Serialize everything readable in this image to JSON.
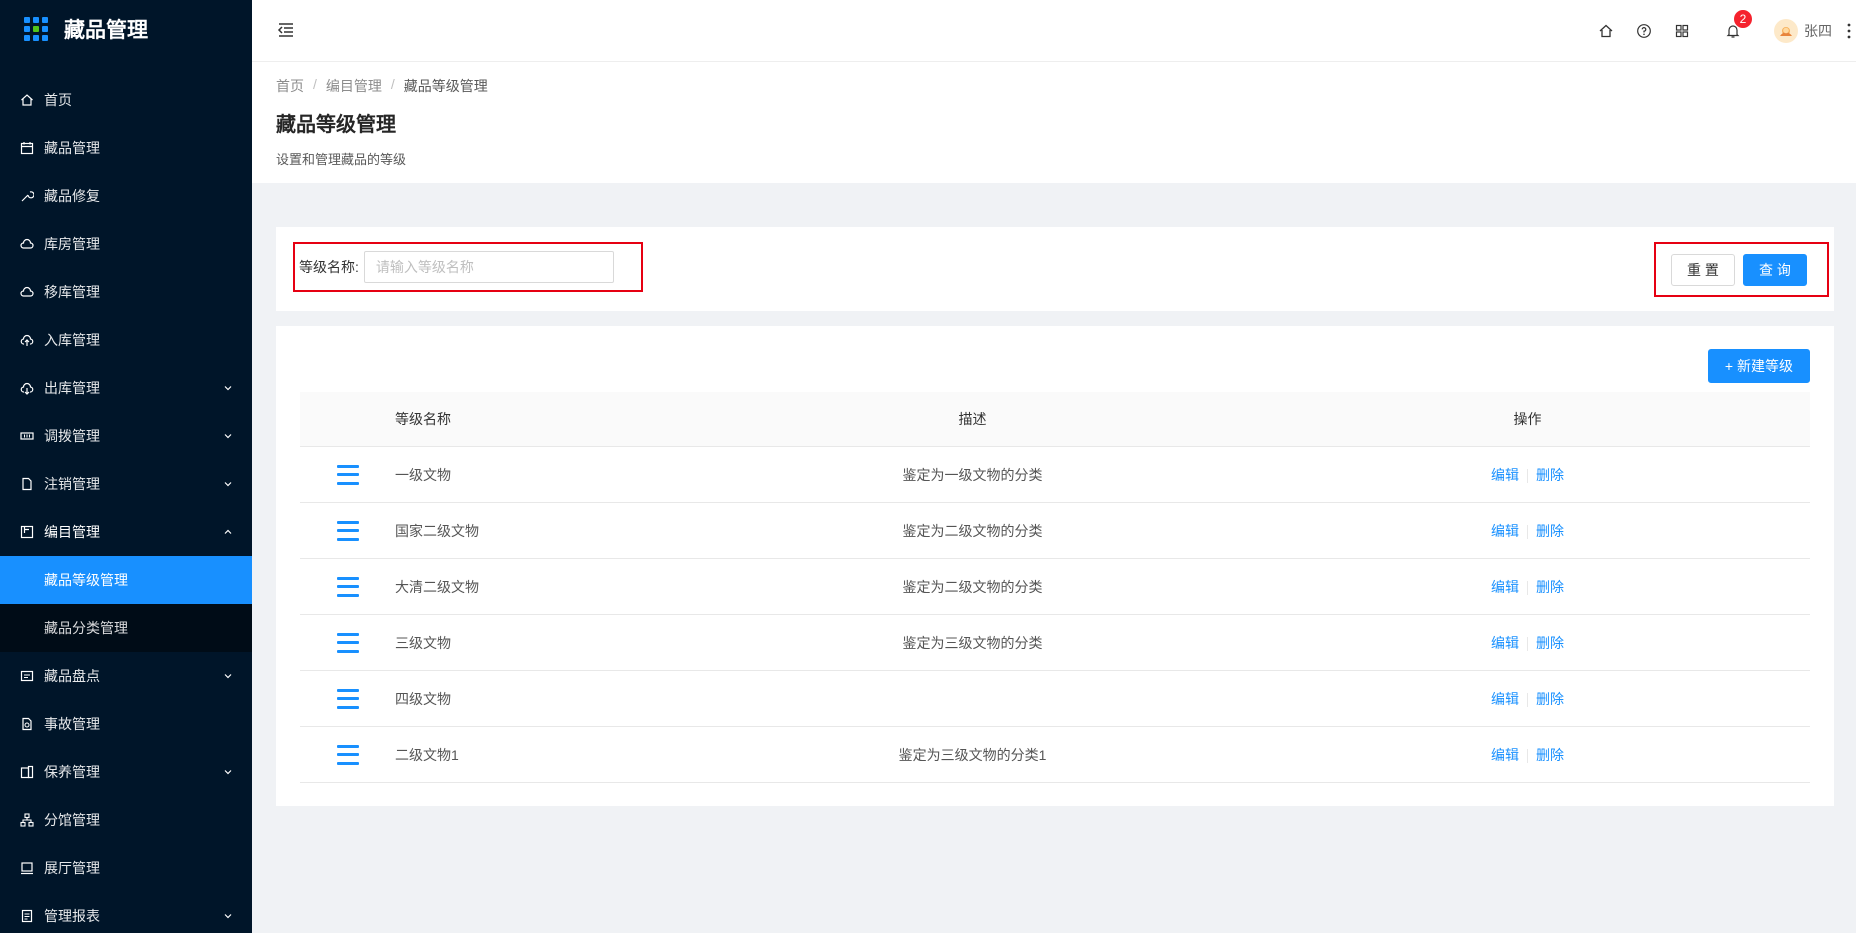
{
  "app": {
    "title": "藏品管理"
  },
  "sidebar": {
    "items": [
      {
        "label": "首页",
        "icon": "home-icon"
      },
      {
        "label": "藏品管理",
        "icon": "calendar-icon"
      },
      {
        "label": "藏品修复",
        "icon": "wrench-icon"
      },
      {
        "label": "库房管理",
        "icon": "cloud-icon"
      },
      {
        "label": "移库管理",
        "icon": "cloud-icon"
      },
      {
        "label": "入库管理",
        "icon": "cloud-upload-icon"
      },
      {
        "label": "出库管理",
        "icon": "cloud-download-icon",
        "expandable": true
      },
      {
        "label": "调拨管理",
        "icon": "transfer-icon",
        "expandable": true
      },
      {
        "label": "注销管理",
        "icon": "file-icon",
        "expandable": true
      },
      {
        "label": "编目管理",
        "icon": "catalog-icon",
        "expandable": true,
        "open": true,
        "children": [
          {
            "label": "藏品等级管理",
            "active": true
          },
          {
            "label": "藏品分类管理"
          }
        ]
      },
      {
        "label": "藏品盘点",
        "icon": "inventory-icon",
        "expandable": true
      },
      {
        "label": "事故管理",
        "icon": "accident-icon"
      },
      {
        "label": "保养管理",
        "icon": "maintenance-icon",
        "expandable": true
      },
      {
        "label": "分馆管理",
        "icon": "branch-icon"
      },
      {
        "label": "展厅管理",
        "icon": "monitor-icon"
      },
      {
        "label": "管理报表",
        "icon": "report-icon",
        "expandable": true
      }
    ]
  },
  "header": {
    "notification_count": "2",
    "username": "张四"
  },
  "page": {
    "breadcrumb": [
      "首页",
      "编目管理",
      "藏品等级管理"
    ],
    "title": "藏品等级管理",
    "description": "设置和管理藏品的等级"
  },
  "search": {
    "label": "等级名称:",
    "placeholder": "请输入等级名称",
    "value": "",
    "reset_label": "重 置",
    "query_label": "查 询"
  },
  "table": {
    "new_button_label": "+ 新建等级",
    "columns": [
      "等级名称",
      "描述",
      "操作"
    ],
    "edit_label": "编辑",
    "delete_label": "删除",
    "rows": [
      {
        "name": "一级文物",
        "desc": "鉴定为一级文物的分类"
      },
      {
        "name": "国家二级文物",
        "desc": "鉴定为二级文物的分类"
      },
      {
        "name": "大清二级文物",
        "desc": "鉴定为二级文物的分类"
      },
      {
        "name": "三级文物",
        "desc": "鉴定为三级文物的分类"
      },
      {
        "name": "四级文物",
        "desc": ""
      },
      {
        "name": "二级文物1",
        "desc": "鉴定为三级文物的分类1"
      }
    ]
  },
  "colors": {
    "sidebar_bg": "#001529",
    "primary": "#1890ff",
    "highlight_border": "#e60012",
    "badge": "#f5222d"
  }
}
